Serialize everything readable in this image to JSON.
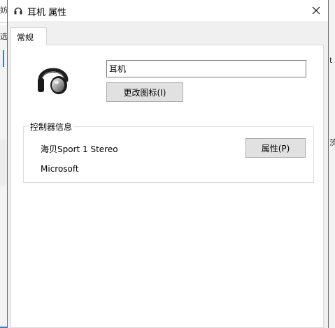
{
  "background": {
    "left_glyph_1": "妨",
    "left_glyph_2": "选",
    "right_glyph_1": "t",
    "right_glyph_2": "茨"
  },
  "window": {
    "title": "耳机 属性",
    "title_icon": "headphones-icon",
    "close_glyph": "×"
  },
  "tabs": [
    {
      "label": "常规",
      "selected": true
    }
  ],
  "general": {
    "device_icon": "headphones-icon",
    "device_name": "耳机",
    "change_icon_label": "更改图标(I)",
    "controller_info": {
      "title": "控制器信息",
      "driver": "海贝Sport 1 Stereo",
      "vendor": "Microsoft",
      "properties_label": "属性(P)"
    }
  },
  "colors": {
    "content_bg": "#f0f0f0",
    "page_bg": "#ffffff",
    "button_bg": "#e1e1e1",
    "button_border": "#adadad"
  }
}
